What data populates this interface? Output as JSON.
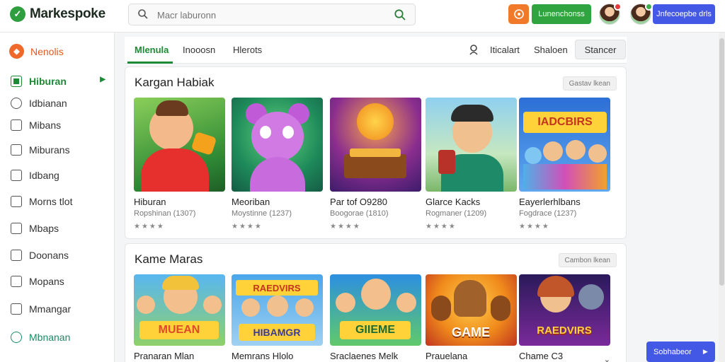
{
  "header": {
    "logo_text": "Markespoke",
    "search_placeholder": "Macr laburonn",
    "green_button": "Lunenchonss",
    "blue_button": "Jnfecoepbe drls",
    "colors": {
      "brand_green": "#30a53f",
      "orange": "#f07a2a",
      "blue": "#4458e6"
    }
  },
  "sidebar": {
    "top_item": "Nenolis",
    "items": [
      {
        "label": "Hiburan",
        "icon": "game-icon",
        "active": true
      },
      {
        "label": "Idbianan",
        "icon": "clock-icon"
      },
      {
        "label": "Mibans",
        "icon": "check-icon"
      },
      {
        "label": "Miburans",
        "icon": "image-icon"
      },
      {
        "label": "Idbang",
        "icon": "list-icon"
      },
      {
        "label": "Morns tlot",
        "icon": "document-icon"
      },
      {
        "label": "Mbaps",
        "icon": "home-icon"
      },
      {
        "label": "Doonans",
        "icon": "page-icon"
      },
      {
        "label": "Mopans",
        "icon": "file-icon"
      },
      {
        "label": "Mmangar",
        "icon": "calendar-icon"
      },
      {
        "label": "Mbnanan",
        "icon": "circle-icon"
      }
    ]
  },
  "tabs": {
    "items": [
      "Mlenula",
      "Inooosn",
      "Hlerots"
    ],
    "right_links": [
      "Iticalart",
      "Shaloen"
    ],
    "button": "Stancer"
  },
  "section1": {
    "title": "Kargan Habiak",
    "button": "Gastav lkean",
    "cards": [
      {
        "name": "Hiburan",
        "meta": "Ropshinan (1307)",
        "stars": "★★★★"
      },
      {
        "name": "Meoriban",
        "meta": "Moystinne (1237)",
        "stars": "★★★★"
      },
      {
        "name": "Par tof O9280",
        "meta": "Boogorae (1810)",
        "stars": "★★★★"
      },
      {
        "name": "Glarce Kacks",
        "meta": "Rogmaner (1209)",
        "stars": "★★★★"
      },
      {
        "name": "Eayerlerhlbans",
        "meta": "Fogdrace (1237)",
        "stars": "★★★★"
      }
    ]
  },
  "section2": {
    "title": "Kame Maras",
    "button": "Cambon lkean",
    "cards": [
      {
        "name": "Pranaran Mlan",
        "thumb_text": "MUEAN"
      },
      {
        "name": "Memrans Hlolo",
        "thumb_text": "HIBAMGR"
      },
      {
        "name": "Sraclaenes Melk",
        "thumb_text": "GIIEME"
      },
      {
        "name": "Prauelana",
        "thumb_text": "GAME"
      },
      {
        "name": "Chame C3",
        "thumb_text": "RAEDVIRS"
      }
    ]
  },
  "floating_button": "Sobhabeor"
}
